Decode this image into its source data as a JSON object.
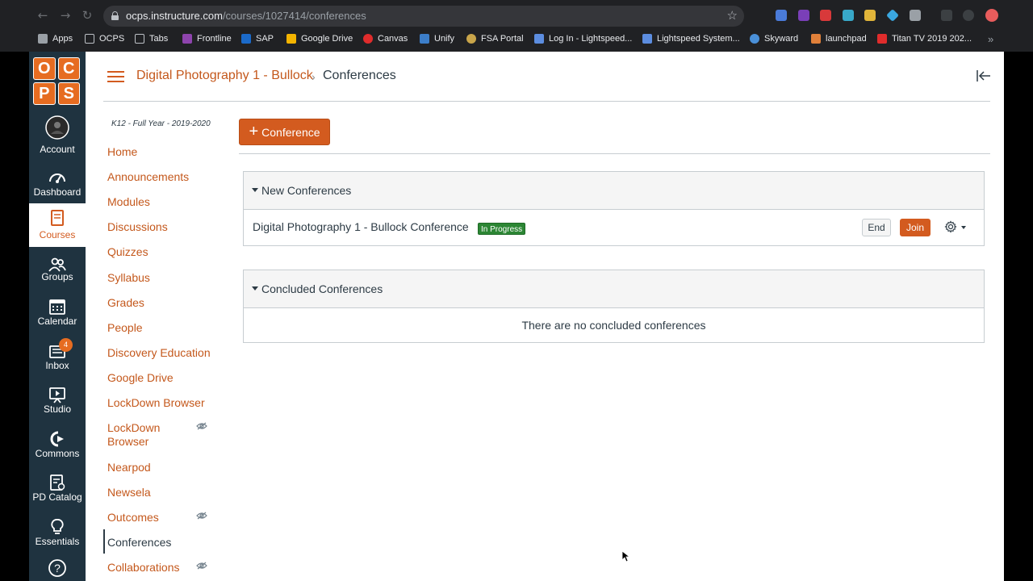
{
  "browser": {
    "url_host": "ocps.instructure.com",
    "url_path": "/courses/1027414/conferences",
    "bookmarks": [
      "Apps",
      "OCPS",
      "Tabs",
      "Frontline",
      "SAP",
      "Google Drive",
      "Canvas",
      "Unify",
      "FSA Portal",
      "Log In - Lightspeed...",
      "Lightspeed System...",
      "Skyward",
      "launchpad",
      "Titan TV 2019 202..."
    ],
    "bookmarks_more": "»"
  },
  "logo": [
    "O",
    "C",
    "P",
    "S"
  ],
  "global_nav": {
    "account": "Account",
    "dashboard": "Dashboard",
    "courses": "Courses",
    "groups": "Groups",
    "calendar": "Calendar",
    "inbox": "Inbox",
    "inbox_badge": "4",
    "studio": "Studio",
    "commons": "Commons",
    "pd_catalog": "PD Catalog",
    "essentials": "Essentials"
  },
  "breadcrumb": {
    "course": "Digital Photography 1 - Bullock",
    "separator": "›",
    "current": "Conferences"
  },
  "course_nav": {
    "term": "K12 - Full Year - 2019-2020",
    "items": [
      "Home",
      "Announcements",
      "Modules",
      "Discussions",
      "Quizzes",
      "Syllabus",
      "Grades",
      "People",
      "Discovery Education",
      "Google Drive",
      "LockDown Browser",
      "LockDown Browser",
      "Nearpod",
      "Newsela",
      "Outcomes",
      "Conferences",
      "Collaborations"
    ]
  },
  "toolbar": {
    "add_conference": "Conference"
  },
  "new_conferences": {
    "title": "New Conferences",
    "conference_name": "Digital Photography 1 - Bullock Conference",
    "status": "In Progress",
    "end": "End",
    "join": "Join"
  },
  "concluded_conferences": {
    "title": "Concluded Conferences",
    "empty_text": "There are no concluded conferences"
  },
  "colors": {
    "brand_orange": "#d35b1f",
    "nav_dark": "#1f3340",
    "status_green": "#2c8634"
  }
}
